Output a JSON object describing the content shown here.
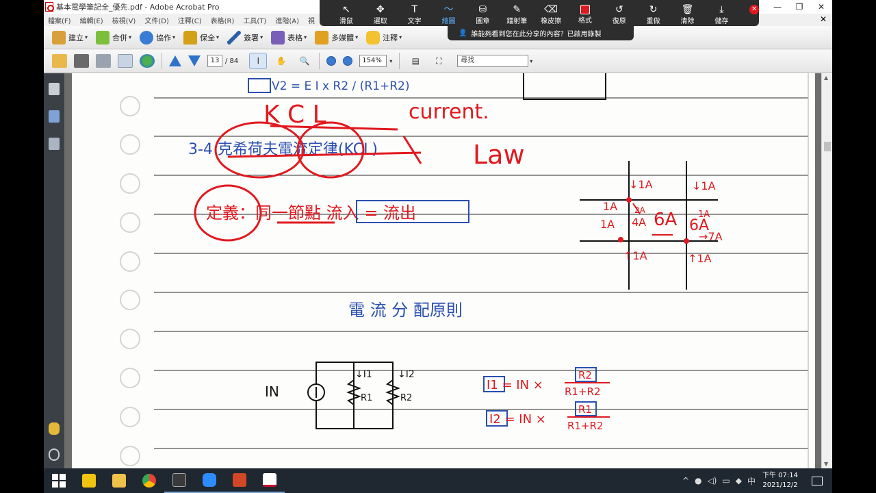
{
  "window": {
    "title": "基本電學筆記全_優先.pdf - Adobe Acrobat Pro",
    "controls": [
      "—",
      "❐",
      "✕"
    ]
  },
  "menu": [
    "檔案(F)",
    "編輯(E)",
    "檢視(V)",
    "文件(D)",
    "注釋(C)",
    "表格(R)",
    "工具(T)",
    "進階(A)",
    "視"
  ],
  "tasks": [
    {
      "label": "建立",
      "icon": "create-pdf-icon"
    },
    {
      "label": "合併",
      "icon": "combine-icon"
    },
    {
      "label": "協作",
      "icon": "collaborate-icon"
    },
    {
      "label": "保全",
      "icon": "lock-icon"
    },
    {
      "label": "簽署",
      "icon": "pen-icon"
    },
    {
      "label": "表格",
      "icon": "forms-icon"
    },
    {
      "label": "多媒體",
      "icon": "multimedia-icon"
    },
    {
      "label": "注釋",
      "icon": "comment-icon"
    }
  ],
  "navigation": {
    "current_page": "13",
    "total_pages": "/ 84",
    "zoom": "154%",
    "find_placeholder": "尋找"
  },
  "annotation_toolbar": {
    "tools": [
      {
        "label": "滑鼠",
        "glyph": "↖"
      },
      {
        "label": "選取",
        "glyph": "✥"
      },
      {
        "label": "文字",
        "glyph": "T"
      },
      {
        "label": "繪圖",
        "glyph": "〜",
        "active": true
      },
      {
        "label": "圖章",
        "glyph": "⛁"
      },
      {
        "label": "鐳射筆",
        "glyph": "✎"
      },
      {
        "label": "橡皮擦",
        "glyph": "⌫"
      },
      {
        "label": "格式",
        "glyph": "■"
      },
      {
        "label": "復原",
        "glyph": "↺"
      },
      {
        "label": "重做",
        "glyph": "↻"
      },
      {
        "label": "清除",
        "glyph": "🗑"
      },
      {
        "label": "儲存",
        "glyph": "⤓"
      }
    ],
    "recording_notice": "誰能夠看到您在此分享的內容？已啟用錄製"
  },
  "notes": {
    "formula_v2": "V2 = E I x R2 / (R1+R2)",
    "kcl_letters": "K C L",
    "current_word": "current.",
    "law_word": "Law",
    "section_title": "3-4 克希荷夫電流定律(KCL)",
    "definition": "定義：同一節點 流入 = 流出",
    "subtitle": "電 流 分 配原則",
    "source_label": "IN",
    "i1_label": "↓I1",
    "i2_label": "↓I2",
    "r1_label": "R1",
    "r2_label": "R2",
    "formula_i1_left": "I1 = IN ×",
    "formula_i1_num": "R2",
    "formula_i1_den": "R1+R2",
    "formula_i2_left": "I2 = IN ×",
    "formula_i2_num": "R1",
    "formula_i2_den": "R1+R2",
    "node_labels": [
      "↓1A",
      "↓1A",
      "2A",
      "1A",
      "1A",
      "4A",
      "6A",
      "6A",
      "→7A",
      "↑1A",
      "↑1A",
      "1A"
    ]
  },
  "taskbar": {
    "apps": [
      "start-icon",
      "pin-icon",
      "file-explorer-icon",
      "chrome-icon",
      "calendar-icon",
      "zoom-icon",
      "powerpoint-icon",
      "acrobat-icon"
    ],
    "ime": "中",
    "time": "下午 07:14",
    "date": "2021/12/2"
  }
}
